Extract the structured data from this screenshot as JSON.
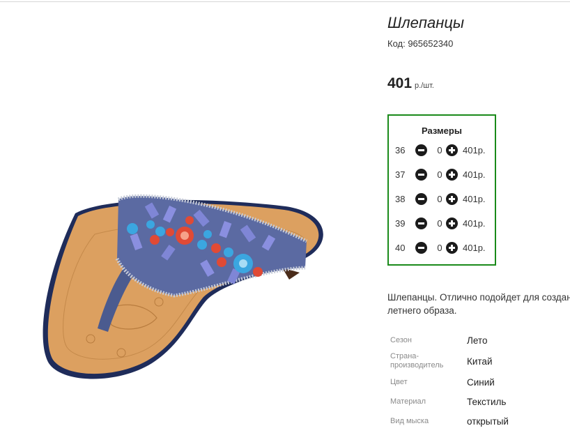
{
  "product": {
    "title": "Шлепанцы",
    "code": "Код: 965652340",
    "price_value": "401",
    "price_unit": "р./шт.",
    "image": "sandal-photo"
  },
  "sizes": {
    "title": "Размеры",
    "rows": [
      {
        "size": "36",
        "qty": "0",
        "price": "401р."
      },
      {
        "size": "37",
        "qty": "0",
        "price": "401р."
      },
      {
        "size": "38",
        "qty": "0",
        "price": "401р."
      },
      {
        "size": "39",
        "qty": "0",
        "price": "401р."
      },
      {
        "size": "40",
        "qty": "0",
        "price": "401р."
      }
    ],
    "minus_icon": "minus-circle-icon",
    "plus_icon": "plus-circle-icon",
    "border_color": "#1a8a1a"
  },
  "description": {
    "line1": "Шлепанцы. Отлично подойдет для создания",
    "line2": "летнего образа."
  },
  "attributes": [
    {
      "label": "Сезон",
      "value": "Лето"
    },
    {
      "label": "Страна-производитель",
      "label_line1": "Страна-",
      "label_line2": "производитель",
      "value": "Китай"
    },
    {
      "label": "Цвет",
      "value": "Синий"
    },
    {
      "label": "Материал",
      "value": "Текстиль"
    },
    {
      "label": "Вид мыска",
      "value": "открытый"
    }
  ]
}
